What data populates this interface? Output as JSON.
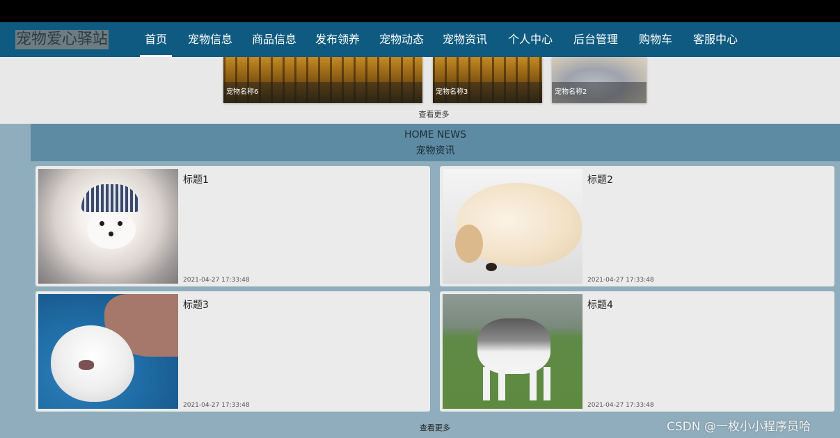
{
  "nav": {
    "logo": "宠物爱心驿站",
    "items": [
      {
        "label": "首页",
        "active": true
      },
      {
        "label": "宠物信息"
      },
      {
        "label": "商品信息"
      },
      {
        "label": "发布领养"
      },
      {
        "label": "宠物动态"
      },
      {
        "label": "宠物资讯"
      },
      {
        "label": "个人中心"
      },
      {
        "label": "后台管理"
      },
      {
        "label": "购物车"
      },
      {
        "label": "客服中心"
      }
    ]
  },
  "gallery": {
    "cards": [
      {
        "caption": "宠物名称6"
      },
      {
        "caption": "宠物名称3"
      },
      {
        "caption": "宠物名称2"
      }
    ],
    "more_label": "查看更多"
  },
  "news": {
    "header_en": "HOME NEWS",
    "header_cn": "宠物资讯",
    "items": [
      {
        "title": "标题1",
        "date": "2021-04-27 17:33:48"
      },
      {
        "title": "标题2",
        "date": "2021-04-27 17:33:48"
      },
      {
        "title": "标题3",
        "date": "2021-04-27 17:33:48"
      },
      {
        "title": "标题4",
        "date": "2021-04-27 17:33:48"
      }
    ],
    "more_label": "查看更多"
  },
  "watermark": "CSDN @一枚小小程序员哈",
  "colors": {
    "nav_bg": "#0e5a80",
    "news_bg": "#8fadbc",
    "news_header_bg": "#5e8ba4"
  }
}
